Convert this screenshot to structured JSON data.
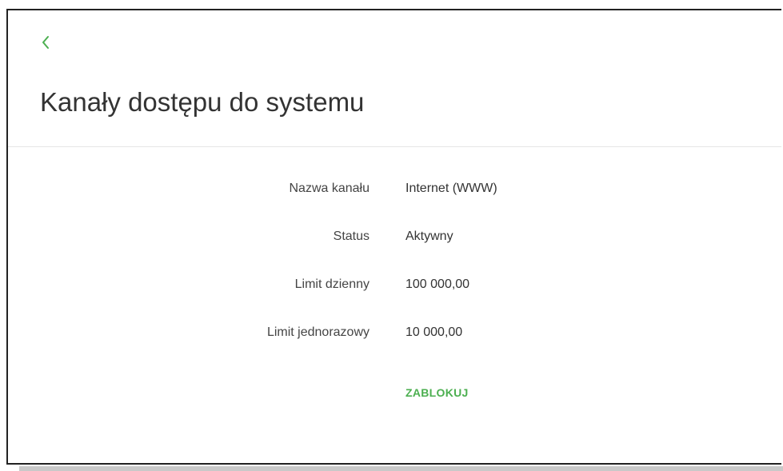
{
  "header": {
    "back_icon": "chevron-left-icon",
    "title": "Kanały dostępu do systemu"
  },
  "details": [
    {
      "label": "Nazwa kanału",
      "value": "Internet (WWW)"
    },
    {
      "label": "Status",
      "value": "Aktywny"
    },
    {
      "label": "Limit dzienny",
      "value": "100 000,00"
    },
    {
      "label": "Limit jednorazowy",
      "value": "10 000,00"
    }
  ],
  "actions": {
    "block_label": "ZABLOKUJ"
  },
  "colors": {
    "accent": "#4caf50",
    "title_text": "#333333",
    "label_text": "#444444"
  }
}
